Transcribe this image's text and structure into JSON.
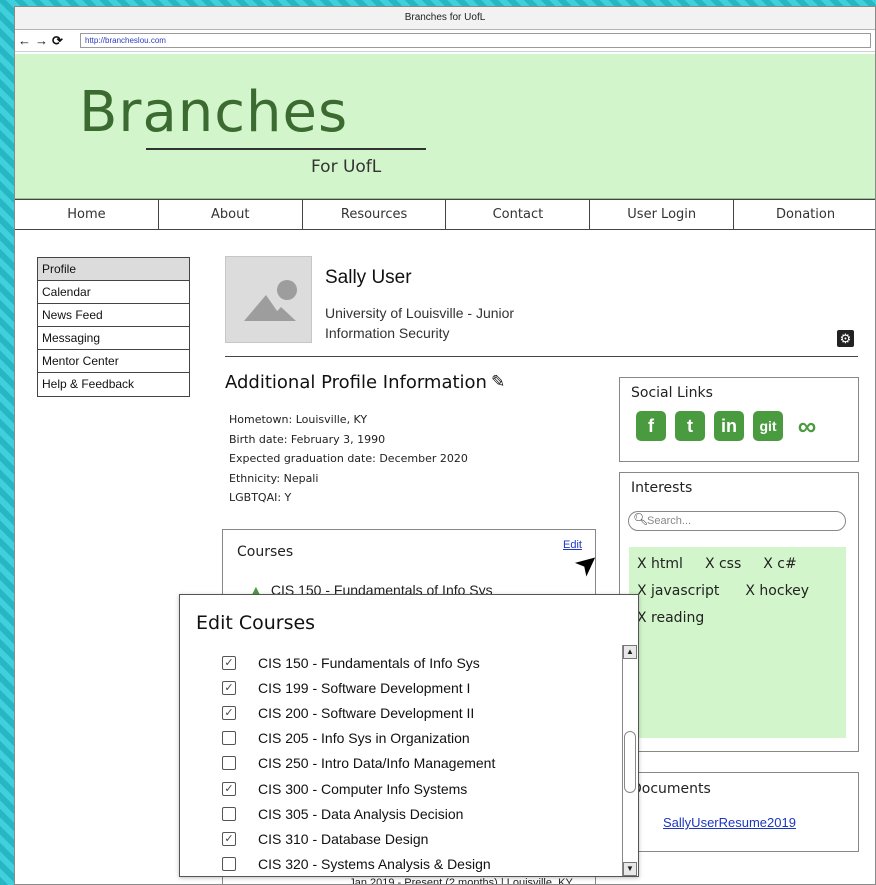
{
  "window": {
    "title": "Branches for UofL"
  },
  "browser": {
    "url": "http://brancheslou.com",
    "back": "←",
    "forward": "→",
    "reload": "⟳"
  },
  "banner": {
    "logo": "Branches",
    "subtitle": "For UofL"
  },
  "topnav": [
    "Home",
    "About",
    "Resources",
    "Contact",
    "User Login",
    "Donation"
  ],
  "sidenav": [
    "Profile",
    "Calendar",
    "News Feed",
    "Messaging",
    "Mentor Center",
    "Help & Feedback"
  ],
  "profile": {
    "name": "Sally User",
    "school": "University of Louisville - Junior",
    "major": "Information Security"
  },
  "additional": {
    "title": "Additional Profile Information",
    "lines": [
      "Hometown: Louisville, KY",
      "Birth date: February 3, 1990",
      "Expected graduation date: December 2020",
      "Ethnicity: Nepali",
      "LGBTQAI: Y"
    ]
  },
  "social": {
    "title": "Social Links",
    "icons": [
      {
        "name": "facebook-icon",
        "glyph": "f"
      },
      {
        "name": "twitter-icon",
        "glyph": "t"
      },
      {
        "name": "linkedin-icon",
        "glyph": "in"
      },
      {
        "name": "git-icon",
        "glyph": "git"
      },
      {
        "name": "link-icon",
        "glyph": "∞"
      }
    ]
  },
  "interests": {
    "title": "Interests",
    "search_placeholder": "Search...",
    "rows": [
      [
        "X html",
        "X css",
        "X c#"
      ],
      [
        "X javascript",
        "X hockey"
      ],
      [
        "X reading"
      ]
    ]
  },
  "documents": {
    "title": "Documents",
    "file": "SallyUserResume2019"
  },
  "courses": {
    "title": "Courses",
    "edit_label": "Edit",
    "first_course": "CIS 150 - Fundamentals of Info Sys"
  },
  "footer": {
    "text": "Jan 2019 - Present (2 months) | Louisville, KY"
  },
  "edit_modal": {
    "title": "Edit Courses",
    "items": [
      {
        "label": "CIS 150 - Fundamentals of Info Sys",
        "checked": true
      },
      {
        "label": "CIS 199 - Software Development I",
        "checked": true
      },
      {
        "label": "CIS 200 - Software Development II",
        "checked": true
      },
      {
        "label": "CIS 205 - Info Sys in Organization",
        "checked": false
      },
      {
        "label": "CIS 250 - Intro Data/Info Management",
        "checked": false
      },
      {
        "label": "CIS 300 - Computer Info Systems",
        "checked": true
      },
      {
        "label": "CIS 305 - Data Analysis Decision",
        "checked": false
      },
      {
        "label": "CIS 310 - Database Design",
        "checked": true
      },
      {
        "label": "CIS 320 - Systems Analysis & Design",
        "checked": false
      }
    ]
  },
  "colors": {
    "accent": "#4a9b3f",
    "banner": "#d3f5cb",
    "link": "#1c37c0"
  }
}
